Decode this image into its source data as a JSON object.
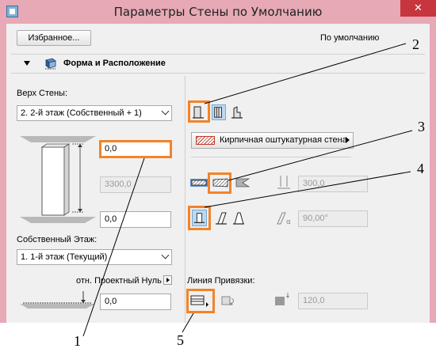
{
  "window": {
    "title": "Параметры Стены по Умолчанию",
    "close_glyph": "✕",
    "accent_color": "#e6a9b5",
    "close_color": "#c7363e",
    "highlight_color": "#f2832a"
  },
  "toolbar": {
    "favorites_label": "Избранное...",
    "default_label": "По умолчанию"
  },
  "section": {
    "title": "Форма и Расположение",
    "icon": "wall-3d-icon"
  },
  "left": {
    "wall_top_label": "Верх Стены:",
    "wall_top_value": "2. 2-й этаж (Собственный + 1)",
    "top_offset": "0,0",
    "height": "3300,0",
    "bottom_offset": "0,0",
    "home_story_label": "Собственный Этаж:",
    "home_story_value": "1. 1-й этаж (Текущий)",
    "ref_zero_label": "отн. Проектный Нуль",
    "base_offset": "0,0"
  },
  "right": {
    "structure_icons": [
      "basic-wall-icon",
      "composite-wall-icon",
      "profile-wall-icon"
    ],
    "material_label": "Кирпичная оштукатурная стена",
    "geometry_icons": [
      "straight-wall-icon",
      "trapezoid-wall-icon",
      "polygonal-wall-icon"
    ],
    "thickness": "300,0",
    "slant_icons": [
      "vertical-wall-icon",
      "slanted-wall-icon",
      "double-slanted-wall-icon"
    ],
    "angle": "90,00°",
    "ref_line_label": "Линия Привязки:",
    "ref_offset": "120,0"
  },
  "callouts": {
    "c1": "1",
    "c2": "2",
    "c3": "3",
    "c4": "4",
    "c5": "5"
  }
}
